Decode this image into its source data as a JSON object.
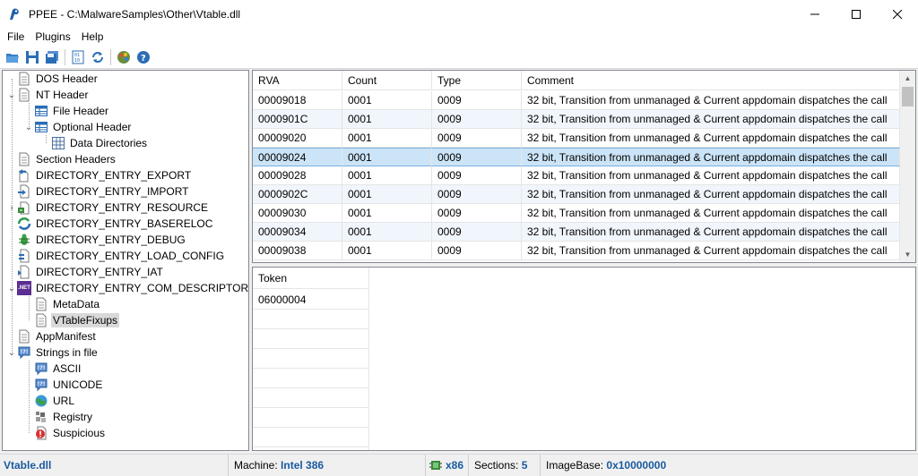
{
  "window": {
    "title": "PPEE - C:\\MalwareSamples\\Other\\Vtable.dll"
  },
  "menu": [
    "File",
    "Plugins",
    "Help"
  ],
  "tree": [
    {
      "label": "DOS Header",
      "icon": "document-icon"
    },
    {
      "label": "NT Header",
      "icon": "document-icon"
    },
    {
      "label": "File Header",
      "icon": "table-icon"
    },
    {
      "label": "Optional Header",
      "icon": "table-icon"
    },
    {
      "label": "Data Directories",
      "icon": "grid-icon"
    },
    {
      "label": "Section Headers",
      "icon": "document-icon"
    },
    {
      "label": "DIRECTORY_ENTRY_EXPORT",
      "icon": "export-icon"
    },
    {
      "label": "DIRECTORY_ENTRY_IMPORT",
      "icon": "import-icon"
    },
    {
      "label": "DIRECTORY_ENTRY_RESOURCE",
      "icon": "resource-icon"
    },
    {
      "label": "DIRECTORY_ENTRY_BASERELOC",
      "icon": "reloc-icon"
    },
    {
      "label": "DIRECTORY_ENTRY_DEBUG",
      "icon": "bug-icon"
    },
    {
      "label": "DIRECTORY_ENTRY_LOAD_CONFIG",
      "icon": "config-icon"
    },
    {
      "label": "DIRECTORY_ENTRY_IAT",
      "icon": "iat-icon"
    },
    {
      "label": "DIRECTORY_ENTRY_COM_DESCRIPTOR",
      "icon": "dotnet-icon",
      "badge": ".NET"
    },
    {
      "label": "MetaData",
      "icon": "document-icon"
    },
    {
      "label": "VTableFixups",
      "icon": "document-icon"
    },
    {
      "label": "AppManifest",
      "icon": "document-icon"
    },
    {
      "label": "Strings in file",
      "icon": "strings-icon"
    },
    {
      "label": "ASCII",
      "icon": "strings-icon"
    },
    {
      "label": "UNICODE",
      "icon": "strings-icon"
    },
    {
      "label": "URL",
      "icon": "globe-icon"
    },
    {
      "label": "Registry",
      "icon": "registry-icon"
    },
    {
      "label": "Suspicious",
      "icon": "warning-icon"
    }
  ],
  "top_table": {
    "columns": [
      "RVA",
      "Count",
      "Type",
      "Comment"
    ],
    "rows": [
      [
        "00009018",
        "0001",
        "0009",
        "32 bit, Transition from unmanaged & Current appdomain dispatches the call"
      ],
      [
        "0000901C",
        "0001",
        "0009",
        "32 bit, Transition from unmanaged & Current appdomain dispatches the call"
      ],
      [
        "00009020",
        "0001",
        "0009",
        "32 bit, Transition from unmanaged & Current appdomain dispatches the call"
      ],
      [
        "00009024",
        "0001",
        "0009",
        "32 bit, Transition from unmanaged & Current appdomain dispatches the call"
      ],
      [
        "00009028",
        "0001",
        "0009",
        "32 bit, Transition from unmanaged & Current appdomain dispatches the call"
      ],
      [
        "0000902C",
        "0001",
        "0009",
        "32 bit, Transition from unmanaged & Current appdomain dispatches the call"
      ],
      [
        "00009030",
        "0001",
        "0009",
        "32 bit, Transition from unmanaged & Current appdomain dispatches the call"
      ],
      [
        "00009034",
        "0001",
        "0009",
        "32 bit, Transition from unmanaged & Current appdomain dispatches the call"
      ],
      [
        "00009038",
        "0001",
        "0009",
        "32 bit, Transition from unmanaged & Current appdomain dispatches the call"
      ]
    ]
  },
  "bottom_table": {
    "columns": [
      "Token"
    ],
    "rows": [
      [
        "06000004"
      ]
    ]
  },
  "status": {
    "file": "Vtable.dll",
    "machine_label": "Machine:",
    "machine": "Intel 386",
    "arch": "x86",
    "sections_label": "Sections:",
    "sections": "5",
    "imagebase_label": "ImageBase:",
    "imagebase": "0x10000000"
  }
}
